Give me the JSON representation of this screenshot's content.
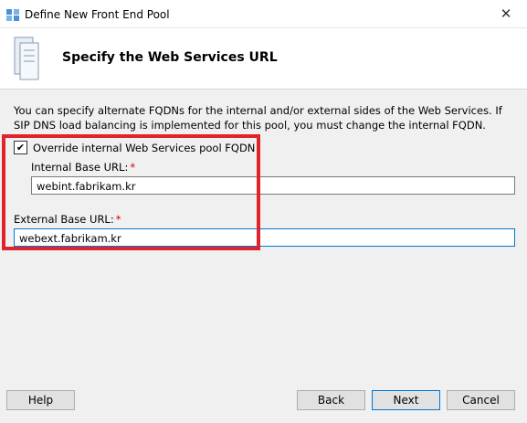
{
  "window": {
    "title": "Define New Front End Pool",
    "close_glyph": "✕"
  },
  "header": {
    "title": "Specify the Web Services URL",
    "icon": "server-icon"
  },
  "content": {
    "description": "You can specify alternate FQDNs for the internal and/or external sides of the Web Services.  If SIP DNS load balancing is implemented for this pool, you must change the internal FQDN.",
    "override_checkbox": {
      "label": "Override internal Web Services pool FQDN",
      "checked": true,
      "check_glyph": "✔"
    },
    "internal": {
      "label": "Internal Base URL:",
      "required_mark": "*",
      "value": "webint.fabrikam.kr"
    },
    "external": {
      "label": "External Base URL:",
      "required_mark": "*",
      "value": "webext.fabrikam.kr"
    }
  },
  "buttons": {
    "help": "Help",
    "back": "Back",
    "next": "Next",
    "cancel": "Cancel"
  },
  "colors": {
    "highlight": "#e0242b",
    "required": "#d00000",
    "focus": "#0078d7"
  }
}
